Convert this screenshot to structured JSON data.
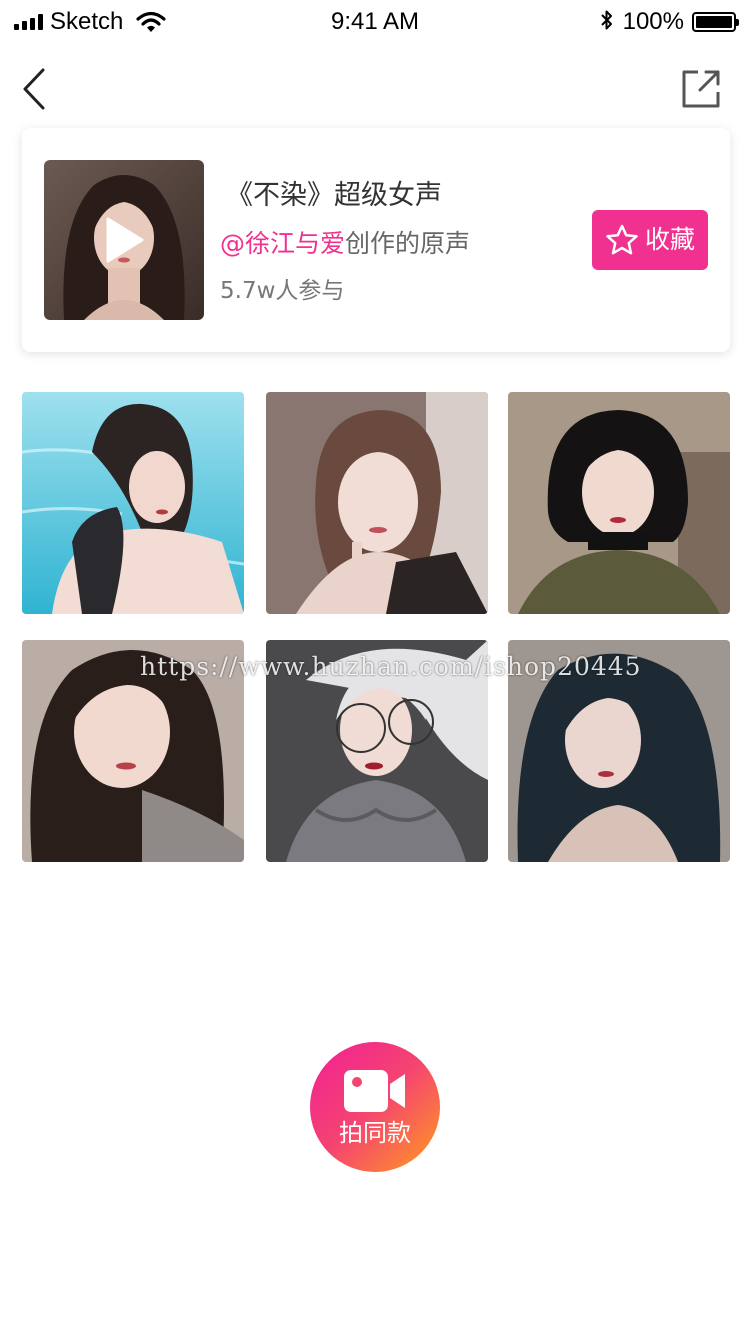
{
  "status_bar": {
    "carrier": "Sketch",
    "time": "9:41 AM",
    "battery": "100%",
    "battery_level": 1.0
  },
  "nav": {
    "back_icon": "chevron-left-icon",
    "share_icon": "share-icon"
  },
  "music": {
    "title": "《不染》超级女声",
    "author": "@徐江与爱",
    "creator_suffix": "创作的原声",
    "participants": "5.7w人参与",
    "collect_label": "收藏",
    "collect_icon": "star-outline-icon",
    "play_icon": "play-icon"
  },
  "watermark": "https://www.huzhan.com/ishop20445",
  "record": {
    "label": "拍同款",
    "icon": "video-camera-icon"
  },
  "colors": {
    "accent": "#f0318f",
    "gradient_start": "#f01e96",
    "gradient_end": "#ff9d1e"
  }
}
